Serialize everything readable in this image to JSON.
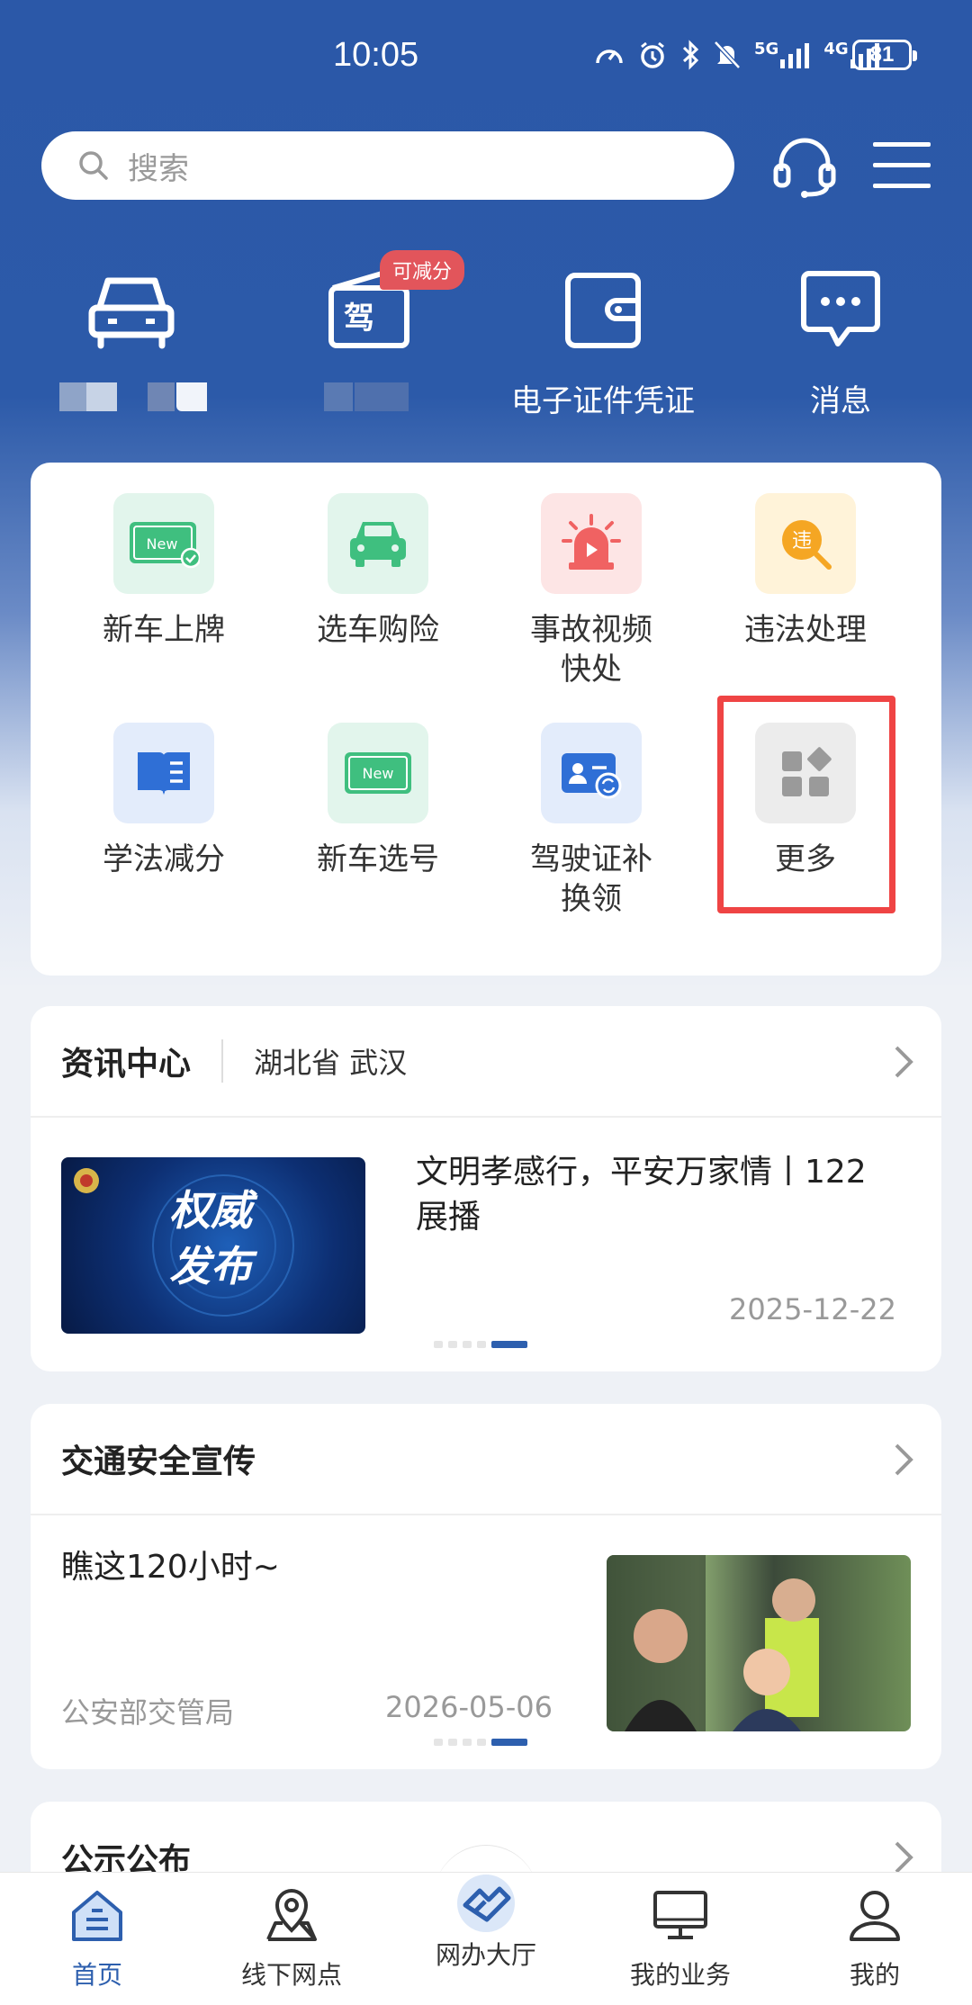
{
  "status_bar": {
    "time": "10:05",
    "battery": "81",
    "network_1": "5G",
    "network_2": "4G"
  },
  "search": {
    "placeholder": "搜索"
  },
  "top_shortcuts": [
    {
      "icon": "car-icon",
      "label": ""
    },
    {
      "icon": "driver-license-icon",
      "label": "",
      "badge": "可减分"
    },
    {
      "icon": "wallet-card-icon",
      "label": "电子证件凭证"
    },
    {
      "icon": "message-icon",
      "label": "消息"
    }
  ],
  "services": [
    {
      "icon": "new-plate-icon",
      "label": "新车上牌"
    },
    {
      "icon": "car-insurance-icon",
      "label": "选车购险"
    },
    {
      "icon": "accident-video-icon",
      "label": "事故视频\n快处"
    },
    {
      "icon": "violation-icon",
      "label": "违法处理"
    },
    {
      "icon": "study-book-icon",
      "label": "学法减分"
    },
    {
      "icon": "new-plate-number-icon",
      "label": "新车选号"
    },
    {
      "icon": "license-replace-icon",
      "label": "驾驶证补\n换领"
    },
    {
      "icon": "more-grid-icon",
      "label": "更多"
    }
  ],
  "tile_text": {
    "new": "New",
    "violation": "违",
    "license": "驾"
  },
  "news_center": {
    "title": "资讯中心",
    "region": "湖北省 武汉",
    "article_title": "文明孝感行，平安万家情丨122展播",
    "image_text": "权威\n发布",
    "date": "2025-12-22"
  },
  "traffic_safety": {
    "title": "交通安全宣传",
    "article_title": "瞧这120小时~",
    "source": "公安部交管局",
    "date": "2026-05-06"
  },
  "notice": {
    "title": "公示公布"
  },
  "bottom_nav": [
    {
      "icon": "home-icon",
      "label": "首页",
      "active": true
    },
    {
      "icon": "map-pin-icon",
      "label": "线下网点",
      "active": false
    },
    {
      "icon": "online-hall-icon",
      "label": "网办大厅",
      "active": false
    },
    {
      "icon": "monitor-icon",
      "label": "我的业务",
      "active": false
    },
    {
      "icon": "user-icon",
      "label": "我的",
      "active": false
    }
  ],
  "colors": {
    "brand_blue": "#2b58a8",
    "accent_red": "#ef4444",
    "badge_red": "#e2555b"
  }
}
